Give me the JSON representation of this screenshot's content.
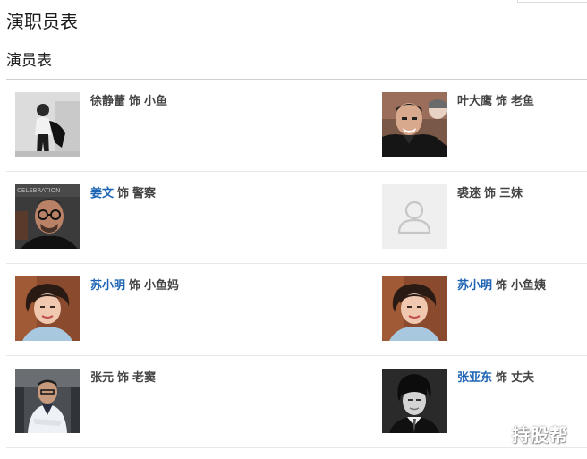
{
  "page": {
    "title": "演职员表",
    "section_title": "演员表",
    "link_color": "#1e64b4",
    "text_color": "#444444"
  },
  "cast": [
    {
      "actor": "徐静蕾",
      "is_link": false,
      "sep": "饰",
      "role": "小鱼",
      "photo": "grayscale-portrait-woman"
    },
    {
      "actor": "叶大鹰",
      "is_link": false,
      "sep": "饰",
      "role": "老鱼",
      "photo": "portrait-man-dark-coat"
    },
    {
      "actor": "姜文",
      "is_link": true,
      "sep": "饰",
      "role": "警察",
      "photo": "portrait-man-glasses"
    },
    {
      "actor": "裘逨",
      "is_link": false,
      "sep": "饰",
      "role": "三妹",
      "photo": "user-placeholder-icon"
    },
    {
      "actor": "苏小明",
      "is_link": true,
      "sep": "饰",
      "role": "小鱼妈",
      "photo": "portrait-woman-short-hair"
    },
    {
      "actor": "苏小明",
      "is_link": true,
      "sep": "饰",
      "role": "小鱼姨",
      "photo": "portrait-woman-short-hair"
    },
    {
      "actor": "张元",
      "is_link": false,
      "sep": "饰",
      "role": "老窦",
      "photo": "portrait-man-white-jacket"
    },
    {
      "actor": "张亚东",
      "is_link": true,
      "sep": "饰",
      "role": "丈夫",
      "photo": "grayscale-portrait-young-man"
    }
  ],
  "watermark": "持股帮"
}
